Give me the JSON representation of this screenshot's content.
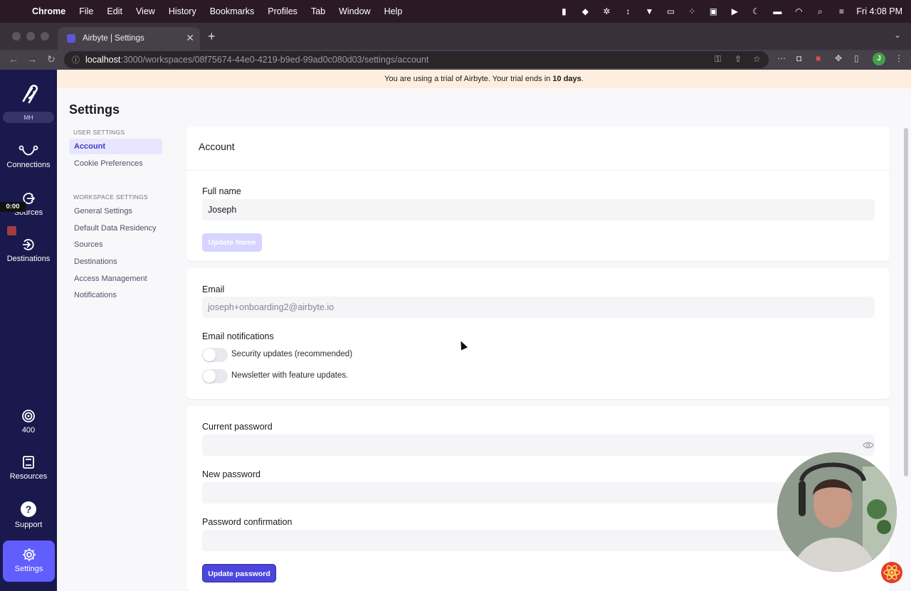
{
  "menubar": {
    "items": [
      "Chrome",
      "File",
      "Edit",
      "View",
      "History",
      "Bookmarks",
      "Profiles",
      "Tab",
      "Window",
      "Help"
    ],
    "clock": "Fri 4:08 PM"
  },
  "browser": {
    "tab_title": "Airbyte | Settings",
    "url_host": "localhost",
    "url_path": ":3000/workspaces/08f75674-44e0-4219-b9ed-99ad0c080d03/settings/account",
    "profile_initial": "J"
  },
  "sidebar": {
    "workspace_initials": "MH",
    "recording_time": "0:00",
    "items": [
      {
        "label": "Connections",
        "icon": "connections-icon"
      },
      {
        "label": "Sources",
        "icon": "sources-icon"
      },
      {
        "label": "Destinations",
        "icon": "destinations-icon"
      },
      {
        "label": "400",
        "icon": "credits-icon"
      },
      {
        "label": "Resources",
        "icon": "book-icon"
      },
      {
        "label": "Support",
        "icon": "help-icon"
      },
      {
        "label": "Settings",
        "icon": "gear-icon"
      }
    ]
  },
  "banner": {
    "prefix": "You are using a trial of Airbyte. Your trial ends in ",
    "strong": "10 days",
    "suffix": "."
  },
  "settings": {
    "title": "Settings",
    "user_section": "USER SETTINGS",
    "user_links": [
      "Account",
      "Cookie Preferences"
    ],
    "workspace_section": "WORKSPACE SETTINGS",
    "workspace_links": [
      "General Settings",
      "Default Data Residency",
      "Sources",
      "Destinations",
      "Access Management",
      "Notifications"
    ]
  },
  "account": {
    "title": "Account",
    "full_name_label": "Full name",
    "full_name_value": "Joseph",
    "update_name_button": "Update Name",
    "email_label": "Email",
    "email_value": "joseph+onboarding2@airbyte.io",
    "email_notifications_label": "Email notifications",
    "toggle_security": "Security updates (recommended)",
    "toggle_newsletter": "Newsletter with feature updates.",
    "current_password_label": "Current password",
    "new_password_label": "New password",
    "password_confirmation_label": "Password confirmation",
    "update_password_button": "Update password"
  },
  "colors": {
    "sidebar": "#1a194d",
    "accent": "#615eff",
    "banner": "#feeee0",
    "primary_button": "#4c46dc"
  }
}
